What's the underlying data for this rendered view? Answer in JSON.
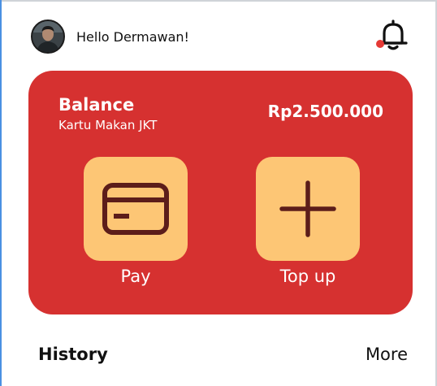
{
  "header": {
    "greeting": "Hello Dermawan!",
    "notification_icon": "bell-icon",
    "notification_badge_color": "#e53935"
  },
  "balance_card": {
    "title": "Balance",
    "card_name": "Kartu Makan JKT",
    "amount": "Rp2.500.000",
    "background_color": "#d63130",
    "actions": [
      {
        "label": "Pay",
        "icon": "credit-card-icon"
      },
      {
        "label": "Top up",
        "icon": "plus-icon"
      }
    ],
    "action_tile_color": "#fdc675",
    "action_icon_color": "#5c1d1a"
  },
  "history": {
    "title": "History",
    "more_label": "More"
  }
}
